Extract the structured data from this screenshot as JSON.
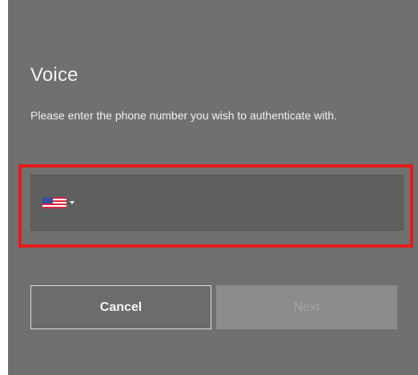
{
  "dialog": {
    "title": "Voice",
    "description": "Please enter the phone number you wish to authenticate with."
  },
  "phone_field": {
    "country_flag": "us-flag-icon",
    "value": "",
    "placeholder": ""
  },
  "buttons": {
    "cancel_label": "Cancel",
    "next_label": "Next"
  },
  "colors": {
    "panel_background": "#707070",
    "highlight_border": "#e81a1a",
    "next_disabled": "#8c8c8c"
  }
}
